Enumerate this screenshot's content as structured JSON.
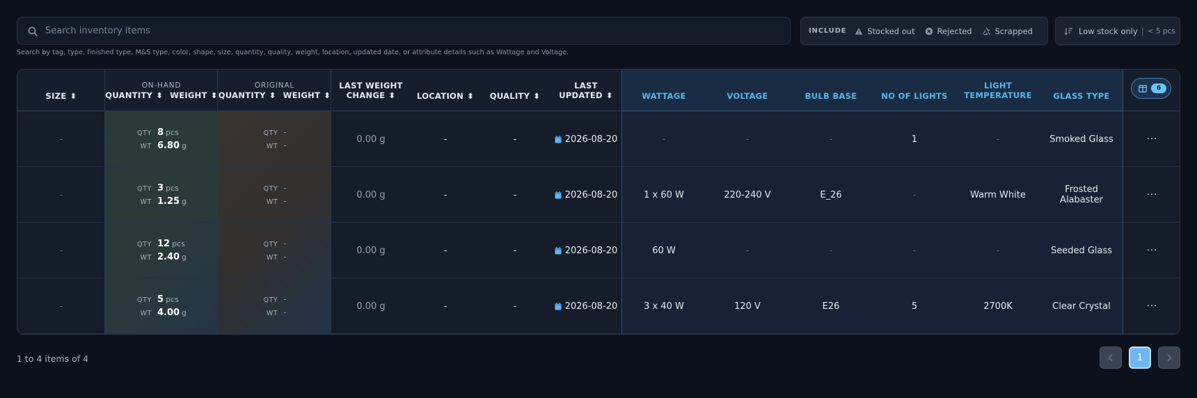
{
  "search": {
    "placeholder": "Search inventory items",
    "hint": "Search by tag, type, finished type, M&S type, color, shape, size, quantity, quality, weight, location, updated date, or attribute details such as Wattage and Voltage."
  },
  "include": {
    "label": "INCLUDE",
    "options": [
      "Stocked out",
      "Rejected",
      "Scrapped"
    ]
  },
  "low_stock": {
    "label": "Low stock only",
    "threshold": "< 5 pcs"
  },
  "columns": {
    "size": "SIZE",
    "on_hand_group": "ON-HAND",
    "original_group": "ORIGINAL",
    "quantity": "QUANTITY",
    "weight": "WEIGHT",
    "last_weight_change_1": "LAST WEIGHT",
    "last_weight_change_2": "CHANGE",
    "location": "LOCATION",
    "quality": "QUALITY",
    "last_updated_1": "LAST",
    "last_updated_2": "UPDATED",
    "wattage": "WATTAGE",
    "voltage": "VOLTAGE",
    "bulb_base": "BULB BASE",
    "no_of_lights": "NO OF LIGHTS",
    "light_temperature_1": "LIGHT",
    "light_temperature_2": "TEMPERATURE",
    "glass_type": "GLASS TYPE",
    "visible_columns_count": "6"
  },
  "labels": {
    "qty": "QTY",
    "wt": "WT",
    "pcs": "pcs",
    "g": "g",
    "dash": "-",
    "more": "···"
  },
  "rows": [
    {
      "size": "-",
      "oh_qty": "8",
      "oh_wt": "6.80",
      "or_qty": "-",
      "or_wt": "-",
      "weight_change": "0.00 g",
      "location": "-",
      "quality": "-",
      "updated": "2026-08-20",
      "wattage": "-",
      "voltage": "-",
      "bulb_base": "-",
      "no_of_lights": "1",
      "light_temperature": "-",
      "glass_type": "Smoked Glass"
    },
    {
      "size": "-",
      "oh_qty": "3",
      "oh_wt": "1.25",
      "or_qty": "-",
      "or_wt": "-",
      "weight_change": "0.00 g",
      "location": "-",
      "quality": "-",
      "updated": "2026-08-20",
      "wattage": "1 x 60 W",
      "voltage": "220-240 V",
      "bulb_base": "E_26",
      "no_of_lights": "-",
      "light_temperature": "Warm White",
      "glass_type": "Frosted Alabaster"
    },
    {
      "size": "-",
      "oh_qty": "12",
      "oh_wt": "2.40",
      "or_qty": "-",
      "or_wt": "-",
      "weight_change": "0.00 g",
      "location": "-",
      "quality": "-",
      "updated": "2026-08-20",
      "wattage": "60 W",
      "voltage": "-",
      "bulb_base": "-",
      "no_of_lights": "-",
      "light_temperature": "-",
      "glass_type": "Seeded Glass"
    },
    {
      "size": "-",
      "oh_qty": "5",
      "oh_wt": "4.00",
      "or_qty": "-",
      "or_wt": "-",
      "weight_change": "0.00 g",
      "location": "-",
      "quality": "-",
      "updated": "2026-08-20",
      "wattage": "3 x 40 W",
      "voltage": "120 V",
      "bulb_base": "E26",
      "no_of_lights": "5",
      "light_temperature": "2700K",
      "glass_type": "Clear Crystal"
    }
  ],
  "pagination": {
    "summary": "1 to 4 items of 4",
    "current_page": "1"
  }
}
